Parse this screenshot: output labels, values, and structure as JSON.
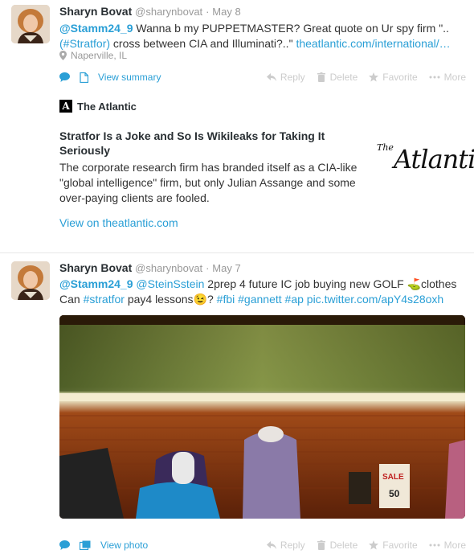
{
  "tweets": [
    {
      "name": "Sharyn Bovat",
      "handle": "@sharynbovat",
      "date": "May 8",
      "text_mention": "@Stamm24_9",
      "text_part1": " Wanna b my PUPPETMASTER? Great quote on Ur spy firm \"..",
      "text_hashtag": "(#Stratfor)",
      "text_part2": " cross between CIA and Illuminati?..\"  ",
      "text_link": "theatlantic.com/international/…",
      "location": "Naperville, IL",
      "expand_label": "View summary",
      "actions": {
        "reply": "Reply",
        "delete": "Delete",
        "favorite": "Favorite",
        "more": "More"
      },
      "card": {
        "brand": "The Atlantic",
        "title": "Stratfor Is a Joke and So Is Wikileaks for Taking It Seriously",
        "description": "The corporate research firm has branded itself as a CIA-like \"global intelligence\" firm, but only Julian Assange and some over-paying clients are fooled.",
        "logo_small": "The",
        "logo_big": "Atlantic",
        "view_link": "View on theatlantic.com"
      }
    },
    {
      "name": "Sharyn Bovat",
      "handle": "@sharynbovat",
      "date": "May 7",
      "mention1": "@Stamm24_9",
      "mention2": "@SteinSstein",
      "text_part1": " 2prep 4 future IC job buying new GOLF ",
      "golf_emoji": "⛳",
      "text_part2": "clothes",
      "text_line2_a": "Can ",
      "hashtag1": "#stratfor",
      "text_line2_b": " pay4 lessons",
      "wink_emoji": "😉",
      "text_line2_c": "? ",
      "hashtag2": "#fbi",
      "hashtag3": "#gannett",
      "hashtag4": "#ap",
      "pic_link": "pic.twitter.com/apY4s28oxh",
      "expand_label": "View photo",
      "photo_sign": "SALE",
      "photo_sign2": "50",
      "actions": {
        "reply": "Reply",
        "delete": "Delete",
        "favorite": "Favorite",
        "more": "More"
      }
    }
  ],
  "colors": {
    "link": "#2a9fd6",
    "muted": "#999999",
    "action": "#cccccc"
  }
}
